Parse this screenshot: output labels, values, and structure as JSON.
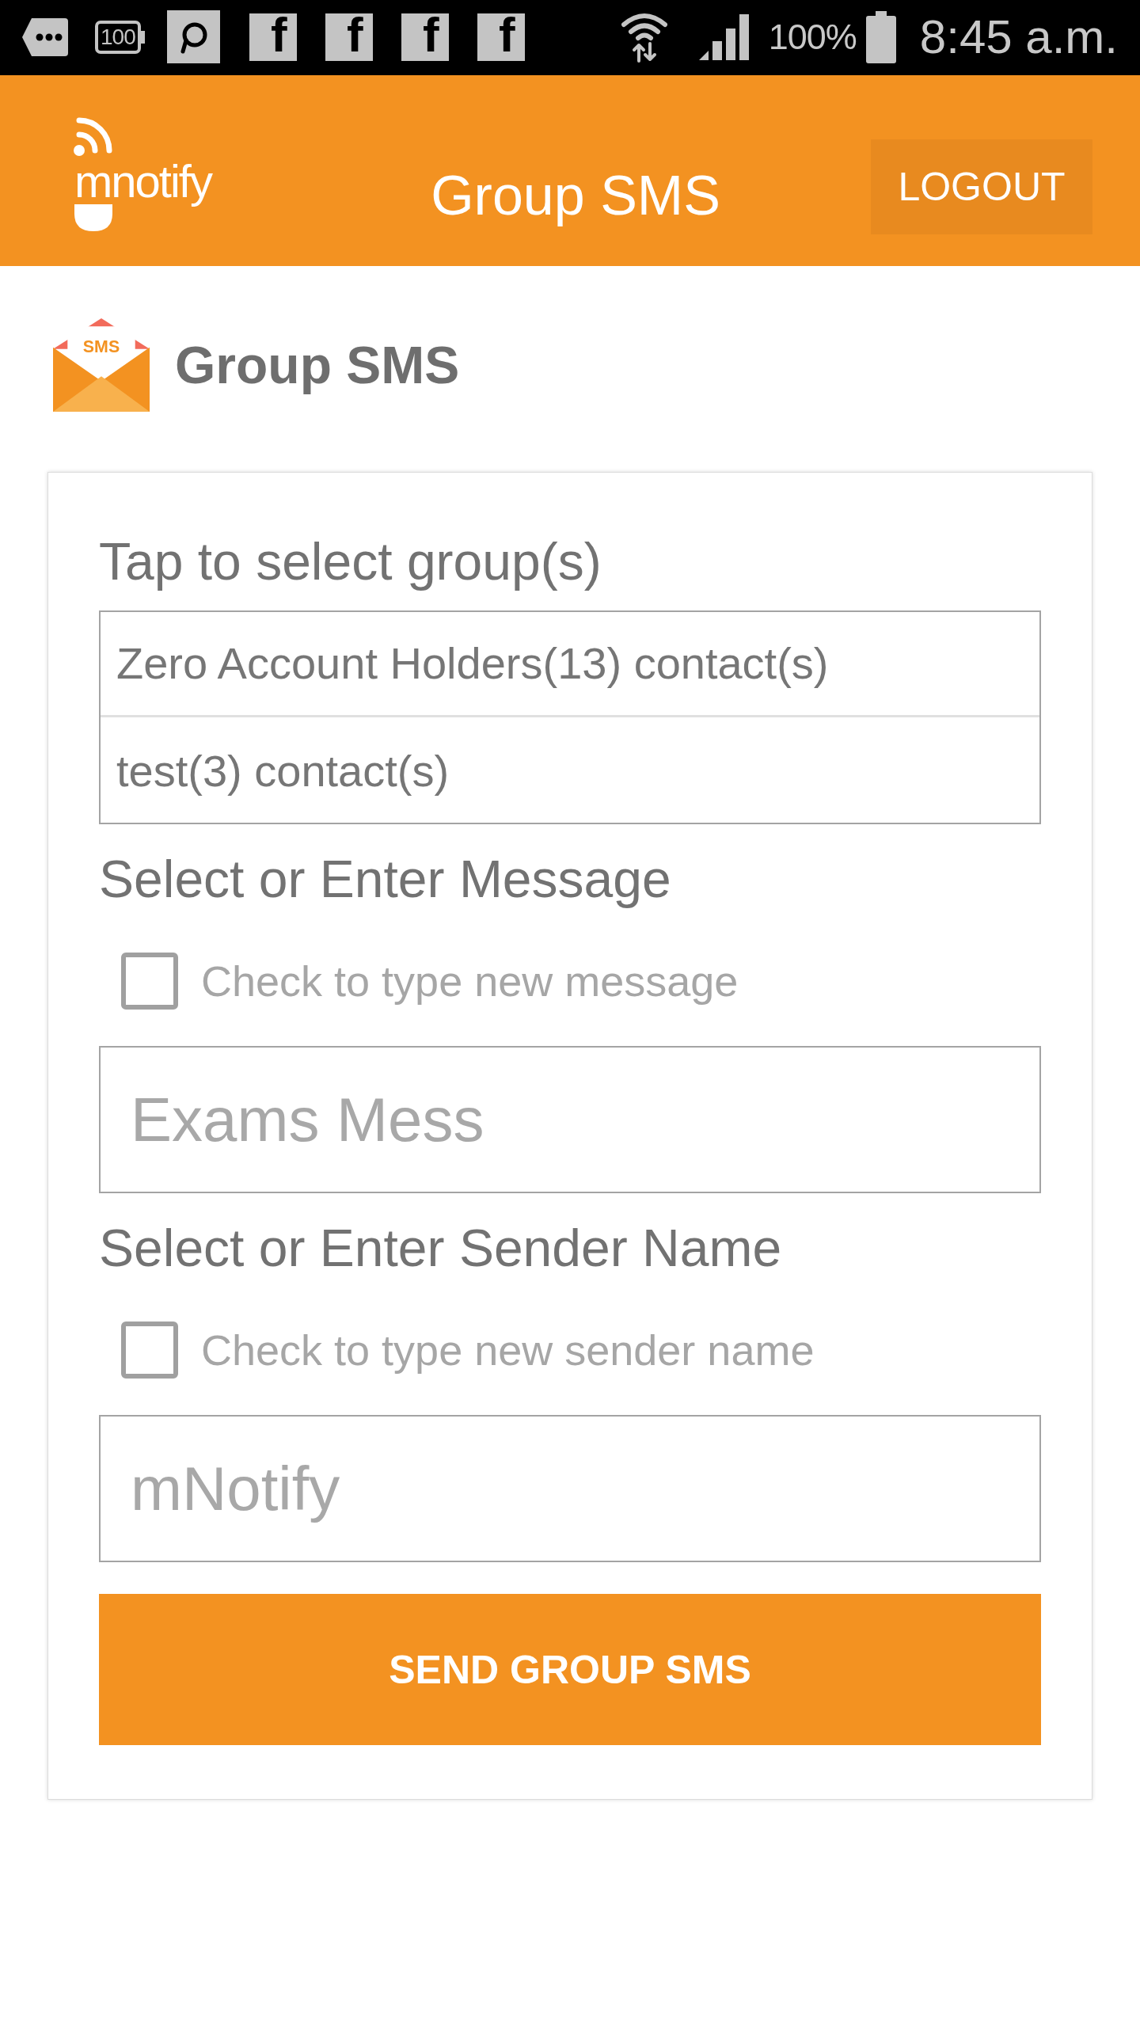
{
  "status_bar": {
    "notifications": [
      {
        "kind": "chat"
      },
      {
        "kind": "battery",
        "text": "100"
      },
      {
        "kind": "bubble"
      },
      {
        "kind": "letter",
        "glyph": "f"
      },
      {
        "kind": "letter",
        "glyph": "f"
      },
      {
        "kind": "letter",
        "glyph": "f"
      },
      {
        "kind": "letter",
        "glyph": "f"
      }
    ],
    "battery_percent": "100%",
    "time": "8:45 a.m."
  },
  "header": {
    "logo": "mnotify",
    "title": "Group SMS",
    "logout_button": "LOGOUT"
  },
  "page_heading": {
    "icon_text": "SMS",
    "title": "Group SMS"
  },
  "form": {
    "groups_label": "Tap to select group(s)",
    "groups": [
      {
        "label": "Zero Account Holders(13) contact(s)"
      },
      {
        "label": "test(3) contact(s)"
      }
    ],
    "message": {
      "label": "Select or Enter Message",
      "checkbox": {
        "label": "Check to type new message",
        "checked": false
      },
      "value": "Exams Mess"
    },
    "sender": {
      "label": "Select or Enter Sender Name",
      "checkbox": {
        "label": "Check to type new sender name",
        "checked": false
      },
      "value": "mNotify"
    },
    "send_button": "SEND GROUP SMS"
  }
}
